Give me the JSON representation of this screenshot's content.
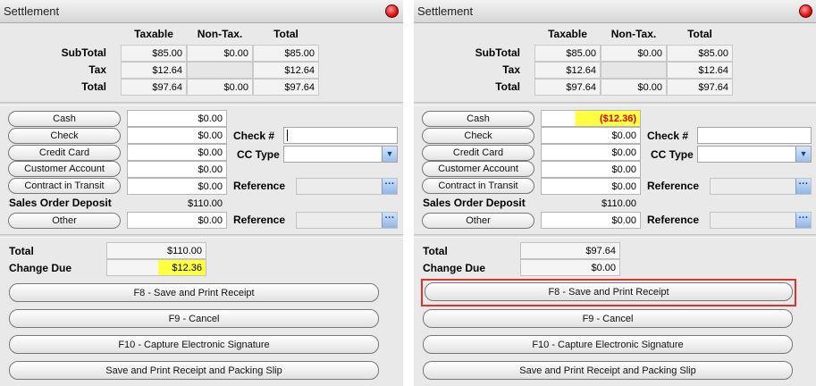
{
  "panels": [
    {
      "title": "Settlement",
      "columns": [
        "Taxable",
        "Non-Tax.",
        "Total"
      ],
      "rows": [
        {
          "label": "SubTotal",
          "taxable": "$85.00",
          "nontax": "$0.00",
          "total": "$85.00"
        },
        {
          "label": "Tax",
          "taxable": "$12.64",
          "nontax": "",
          "total": "$12.64"
        },
        {
          "label": "Total",
          "taxable": "$97.64",
          "nontax": "$0.00",
          "total": "$97.64"
        }
      ],
      "payments": {
        "cash_label": "Cash",
        "cash_value": "$0.00",
        "check_label": "Check",
        "check_value": "$0.00",
        "credit_card_label": "Credit Card",
        "credit_card_value": "$0.00",
        "customer_account_label": "Customer Account",
        "customer_account_value": "$0.00",
        "contract_label": "Contract in Transit",
        "contract_value": "$0.00",
        "sales_order_label": "Sales Order Deposit",
        "sales_order_value": "$110.00",
        "other_label": "Other",
        "other_value": "$0.00"
      },
      "fields": {
        "check_label": "Check #",
        "cc_type_label": "CC Type",
        "reference_label": "Reference",
        "reference2_label": "Reference"
      },
      "summary": {
        "total_label": "Total",
        "total_value": "$110.00",
        "change_label": "Change Due",
        "change_value": "$12.36"
      },
      "actions": [
        "F8 - Save and Print Receipt",
        "F9 - Cancel",
        "F10 - Capture Electronic Signature",
        "Save and Print Receipt and Packing Slip"
      ]
    },
    {
      "title": "Settlement",
      "columns": [
        "Taxable",
        "Non-Tax.",
        "Total"
      ],
      "rows": [
        {
          "label": "SubTotal",
          "taxable": "$85.00",
          "nontax": "$0.00",
          "total": "$85.00"
        },
        {
          "label": "Tax",
          "taxable": "$12.64",
          "nontax": "",
          "total": "$12.64"
        },
        {
          "label": "Total",
          "taxable": "$97.64",
          "nontax": "$0.00",
          "total": "$97.64"
        }
      ],
      "payments": {
        "cash_label": "Cash",
        "cash_value": "($12.36)",
        "check_label": "Check",
        "check_value": "$0.00",
        "credit_card_label": "Credit Card",
        "credit_card_value": "$0.00",
        "customer_account_label": "Customer Account",
        "customer_account_value": "$0.00",
        "contract_label": "Contract in Transit",
        "contract_value": "$0.00",
        "sales_order_label": "Sales Order Deposit",
        "sales_order_value": "$110.00",
        "other_label": "Other",
        "other_value": "$0.00"
      },
      "fields": {
        "check_label": "Check #",
        "cc_type_label": "CC Type",
        "reference_label": "Reference",
        "reference2_label": "Reference"
      },
      "summary": {
        "total_label": "Total",
        "total_value": "$97.64",
        "change_label": "Change Due",
        "change_value": "$0.00"
      },
      "actions": [
        "F8 - Save and Print Receipt",
        "F9 - Cancel",
        "F10 - Capture Electronic Signature",
        "Save and Print Receipt and Packing Slip"
      ]
    }
  ],
  "icons": {
    "close": "close-icon",
    "ellipsis": "ellipsis-icon",
    "dropdown": "chevron-down-icon"
  },
  "colors": {
    "highlight": "#ffff44",
    "negative": "#dd0000",
    "focus_outline": "#e03030"
  }
}
